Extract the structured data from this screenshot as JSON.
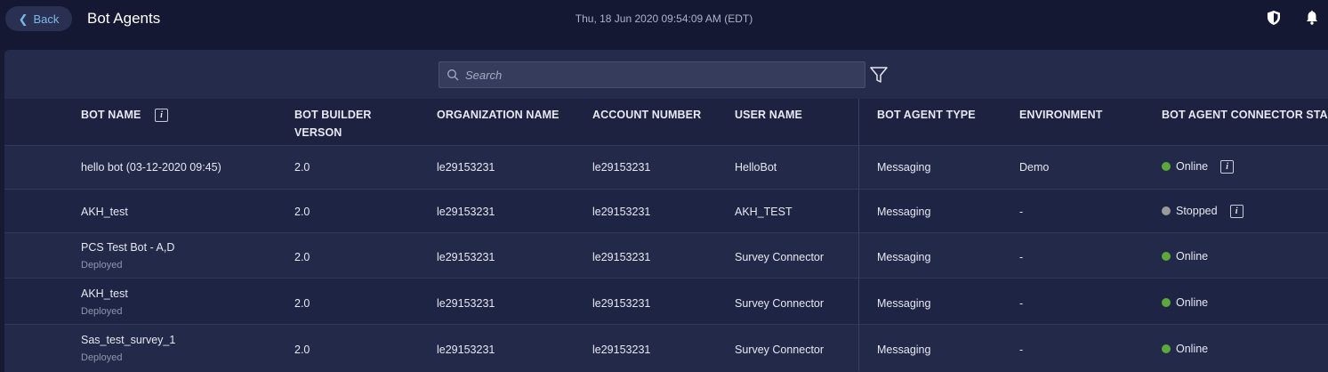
{
  "header": {
    "back_label": "Back",
    "title": "Bot Agents",
    "timestamp": "Thu, 18 Jun 2020 09:54:09 AM (EDT)"
  },
  "search": {
    "placeholder": "Search"
  },
  "table": {
    "columns": {
      "bot_name": "BOT NAME",
      "builder_version_line1": "BOT BUILDER",
      "builder_version_line2": "VERSON",
      "organization": "ORGANIZATION NAME",
      "account": "ACCOUNT NUMBER",
      "user": "USER NAME",
      "agent_type": "BOT AGENT TYPE",
      "environment": "ENVIRONMENT",
      "connector_status": "BOT AGENT CONNECTOR STA"
    },
    "rows": [
      {
        "name": "hello bot (03-12-2020 09:45)",
        "sub": "",
        "version": "2.0",
        "org": "le29153231",
        "account": "le29153231",
        "user": "HelloBot",
        "type": "Messaging",
        "env": "Demo",
        "status": "Online",
        "status_color": "#5ca83a",
        "info": true
      },
      {
        "name": "AKH_test",
        "sub": "",
        "version": "2.0",
        "org": "le29153231",
        "account": "le29153231",
        "user": "AKH_TEST",
        "type": "Messaging",
        "env": "-",
        "status": "Stopped",
        "status_color": "#9a9a9a",
        "info": true
      },
      {
        "name": "PCS Test Bot - A,D",
        "sub": "Deployed",
        "version": "2.0",
        "org": "le29153231",
        "account": "le29153231",
        "user": "Survey Connector",
        "type": "Messaging",
        "env": "-",
        "status": "Online",
        "status_color": "#5ca83a",
        "info": false
      },
      {
        "name": "AKH_test",
        "sub": "Deployed",
        "version": "2.0",
        "org": "le29153231",
        "account": "le29153231",
        "user": "Survey Connector",
        "type": "Messaging",
        "env": "-",
        "status": "Online",
        "status_color": "#5ca83a",
        "info": false
      },
      {
        "name": "Sas_test_survey_1",
        "sub": "Deployed",
        "version": "2.0",
        "org": "le29153231",
        "account": "le29153231",
        "user": "Survey Connector",
        "type": "Messaging",
        "env": "-",
        "status": "Online",
        "status_color": "#5ca83a",
        "info": false
      }
    ]
  },
  "icons": {
    "back": "chevron-left-icon",
    "shield": "shield-icon",
    "bell": "bell-icon",
    "search": "search-icon",
    "filter": "filter-icon",
    "info": "info-icon"
  }
}
